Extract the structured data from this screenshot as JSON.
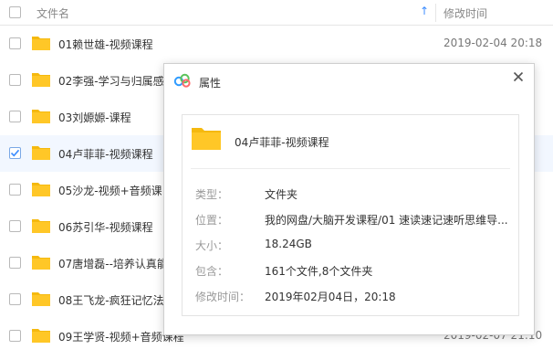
{
  "header": {
    "name_label": "文件名",
    "sort_glyph": "↑",
    "time_label": "修改时间"
  },
  "files": [
    {
      "name": "01赖世雄-视频课程",
      "time": "2019-02-04 20:18",
      "selected": false
    },
    {
      "name": "02李强-学习与归属感",
      "time": "",
      "selected": false
    },
    {
      "name": "03刘嫄嫄-课程",
      "time": "",
      "selected": false
    },
    {
      "name": "04卢菲菲-视频课程",
      "time": "",
      "selected": true
    },
    {
      "name": "05沙龙-视频+音频课",
      "time": "",
      "selected": false
    },
    {
      "name": "06苏引华-视频课程",
      "time": "",
      "selected": false
    },
    {
      "name": "07唐增磊--培养认真能",
      "time": "",
      "selected": false
    },
    {
      "name": "08王飞龙-疯狂记忆法",
      "time": "",
      "selected": false
    },
    {
      "name": "09王学贤-视频+音频课程",
      "time": "2019-02-07 21:10",
      "selected": false
    }
  ],
  "dialog": {
    "title": "属性",
    "close_glyph": "✕",
    "file_name": "04卢菲菲-视频课程",
    "props": [
      {
        "key": "类型：",
        "value": "文件夹"
      },
      {
        "key": "位置：",
        "value": "我的网盘/大脑开发课程/01 速读速记速听思维导..."
      },
      {
        "key": "大小：",
        "value": "18.24GB"
      },
      {
        "key": "包含：",
        "value": "161个文件,8个文件夹"
      },
      {
        "key": "修改时间：",
        "value": "2019年02月04日，20:18"
      }
    ]
  },
  "colors": {
    "folder": "#ffc727",
    "folder_tab": "#f5b90f",
    "selected_row": "#f2f7ff",
    "accent": "#3b8cff"
  },
  "icons": {
    "folder": "folder-icon",
    "close": "close-icon",
    "logo": "baidu-netdisk-logo-icon",
    "sort": "sort-ascending-icon",
    "check": "checkmark-icon"
  }
}
